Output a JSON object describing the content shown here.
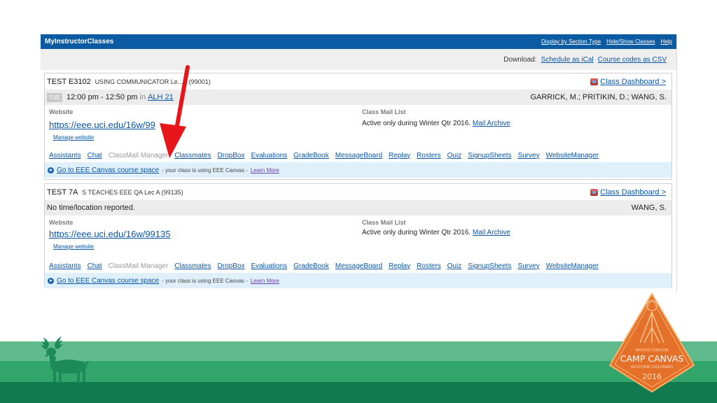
{
  "app": {
    "title": "MyInstructorClasses",
    "top_links": [
      "Display by Section Type",
      "Hide/Show Classes",
      "Help"
    ]
  },
  "download": {
    "label": "Download:",
    "links": [
      "Schedule as iCal",
      "Course codes as CSV"
    ]
  },
  "courses": [
    {
      "code": "TEST E3102",
      "subtitle": "USING COMMUNICATOR Le...B (99001)",
      "dashboard_label": "Class Dashboard >",
      "day": "TUE",
      "time": "12:00 pm - 12:50 pm",
      "in_word": "in",
      "location": "ALH 21",
      "instructors": "GARRICK, M.; PRITIKIN, D.; WANG, S.",
      "website_label": "Website",
      "website_url": "https://eee.uci.edu/16w/99",
      "manage_label": "Manage website",
      "mail_label": "Class Mail List",
      "mail_text": "Active only during Winter Qtr 2016.",
      "mail_archive": "Mail Archive",
      "links": [
        "Assistants",
        "Chat",
        "ClassMail Manager",
        "Classmates",
        "DropBox",
        "Evaluations",
        "GradeBook",
        "MessageBoard",
        "Replay",
        "Rosters",
        "Quiz",
        "SignupSheets",
        "Survey",
        "WebsiteManager"
      ],
      "canvas_link": "Go to EEE Canvas course space",
      "canvas_note": "- your class is using EEE Canvas -",
      "learn_more": "Learn More"
    },
    {
      "code": "TEST 7A",
      "subtitle": "S TEACHES EEE QA Lec A (99135)",
      "dashboard_label": "Class Dashboard >",
      "time_note": "No time/location reported.",
      "instructors": "WANG, S.",
      "website_label": "Website",
      "website_url": "https://eee.uci.edu/16w/99135",
      "manage_label": "Manage website",
      "mail_label": "Class Mail List",
      "mail_text": "Active only during Winter Qtr 2016.",
      "mail_archive": "Mail Archive",
      "links": [
        "Assistants",
        "Chat",
        "ClassMail Manager",
        "Classmates",
        "DropBox",
        "Evaluations",
        "GradeBook",
        "MessageBoard",
        "Replay",
        "Rosters",
        "Quiz",
        "SignupSheets",
        "Survey",
        "WebsiteManager"
      ],
      "canvas_link": "Go to EEE Canvas course space",
      "canvas_note": "- your class is using EEE Canvas -",
      "learn_more": "Learn More"
    }
  ],
  "badge": {
    "top_text": "INSTRUCTURECON",
    "main_text": "CAMP CANVAS",
    "location_text": "KEYSTONE | COLORADO",
    "year": "2016"
  },
  "colors": {
    "header_blue": "#0b5ba3",
    "link_blue": "#0a55a5",
    "arrow_red": "#e8161b",
    "stripe_light": "#5fbb8c",
    "stripe_mid": "#32a56a",
    "stripe_dark": "#117a4f",
    "badge_orange": "#e5702a"
  },
  "icons": [
    "dashboard-icon",
    "canvas-arrow-icon",
    "red-arrow-icon",
    "deer-icon",
    "camp-canvas-badge"
  ]
}
